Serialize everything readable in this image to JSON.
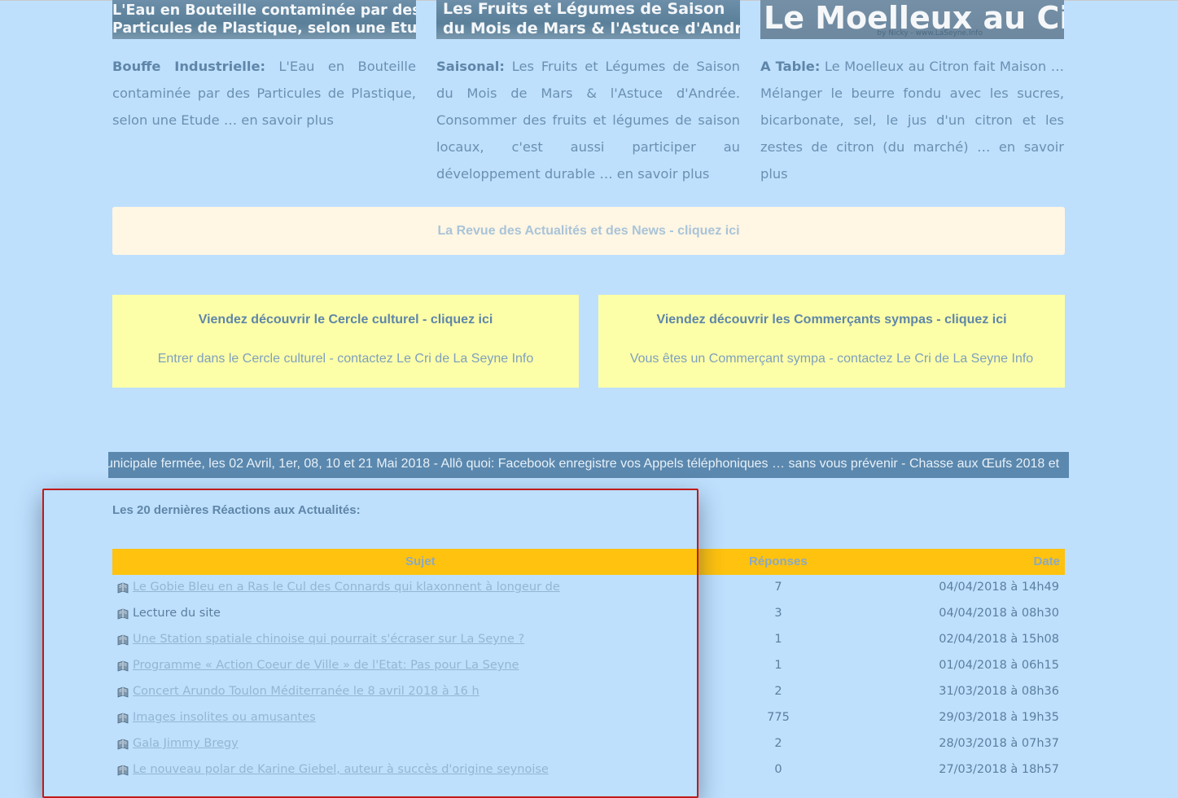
{
  "articles": [
    {
      "thumb_lines": [
        "L'Eau en Bouteille contaminée par des",
        "Particules de Plastique, selon une Etude"
      ],
      "category": "Bouffe Industrielle:",
      "text": "L'Eau en Bouteille contaminée par des Particules de Plastique, selon une Etude",
      "more": "… en savoir plus"
    },
    {
      "thumb_lines": [
        "Les Fruits et Légumes de Saison",
        "du Mois de Mars & l'Astuce d'Andrée"
      ],
      "category": "Saisonal:",
      "text": "Les Fruits et Légumes de Saison du Mois de Mars & l'Astuce d'Andrée. Consommer des fruits et légumes de saison locaux, c'est aussi participer au développement durable",
      "more": "… en savoir plus"
    },
    {
      "thumb_lines": [
        "Le Moelleux au Citron"
      ],
      "thumb_credit": "by Nicky - www.LaSeyne.Info",
      "category": "A Table:",
      "text": "Le Moelleux au Citron fait Maison … Mélanger le beurre fondu avec les sucres, bicarbonate, sel, le jus d'un citron et les zestes de citron (du marché)",
      "more": "… en savoir plus"
    }
  ],
  "revue_banner": "La Revue des  Actualités et des News - cliquez ici",
  "boxes": [
    {
      "title": "Viendez découvrir le Cercle culturel - cliquez ici",
      "subtitle": "Entrer dans le Cercle culturel - contactez Le Cri de La Seyne Info"
    },
    {
      "title": "Viendez découvrir les Commerçants sympas - cliquez ici",
      "subtitle": "Vous êtes un Commerçant sympa - contactez Le Cri de La Seyne Info"
    }
  ],
  "ticker": "unicipale fermée, les 02 Avril, 1er, 08, 10 et 21 Mai 2018 - Allô quoi: Facebook enregistre vos Appels téléphoniques … sans vous prévenir - Chasse aux Œufs 2018 et",
  "reactions": {
    "title": "Les 20 dernières Réactions aux Actualités:",
    "headers": {
      "sujet": "Sujet",
      "reponses": "Réponses",
      "date": "Date"
    },
    "rows": [
      {
        "sujet": "Le Gobie Bleu en a Ras le Cul des Connards qui klaxonnent à longeur de",
        "reponses": "7",
        "date": "04/04/2018 à 14h49",
        "link": true
      },
      {
        "sujet": "Lecture du site",
        "reponses": "3",
        "date": "04/04/2018 à 08h30",
        "link": false
      },
      {
        "sujet": "Une Station spatiale chinoise qui pourrait s'écraser sur La Seyne ?",
        "reponses": "1",
        "date": "02/04/2018 à 15h08",
        "link": true
      },
      {
        "sujet": "Programme « Action Coeur de Ville » de l'Etat: Pas pour La Seyne",
        "reponses": "1",
        "date": "01/04/2018 à 06h15",
        "link": true
      },
      {
        "sujet": "Concert Arundo Toulon Méditerranée le 8 avril 2018 à 16 h",
        "reponses": "2",
        "date": "31/03/2018 à 08h36",
        "link": true
      },
      {
        "sujet": "Images insolites ou amusantes",
        "reponses": "775",
        "date": "29/03/2018 à 19h35",
        "link": true
      },
      {
        "sujet": "Gala Jimmy Bregy",
        "reponses": "2",
        "date": "28/03/2018 à 07h37",
        "link": true
      },
      {
        "sujet": "Le nouveau polar de Karine Giebel, auteur à succès d'origine seynoise",
        "reponses": "0",
        "date": "27/03/2018 à 18h57",
        "link": true
      }
    ]
  },
  "icons": {
    "row_icon": "book-icon"
  },
  "colors": {
    "background": "#bee0fd",
    "header_bar": "#ffc20e",
    "ticker_bg": "#5b88ae",
    "box_yellow": "#fdffa8",
    "highlight": "#c01a1a"
  }
}
